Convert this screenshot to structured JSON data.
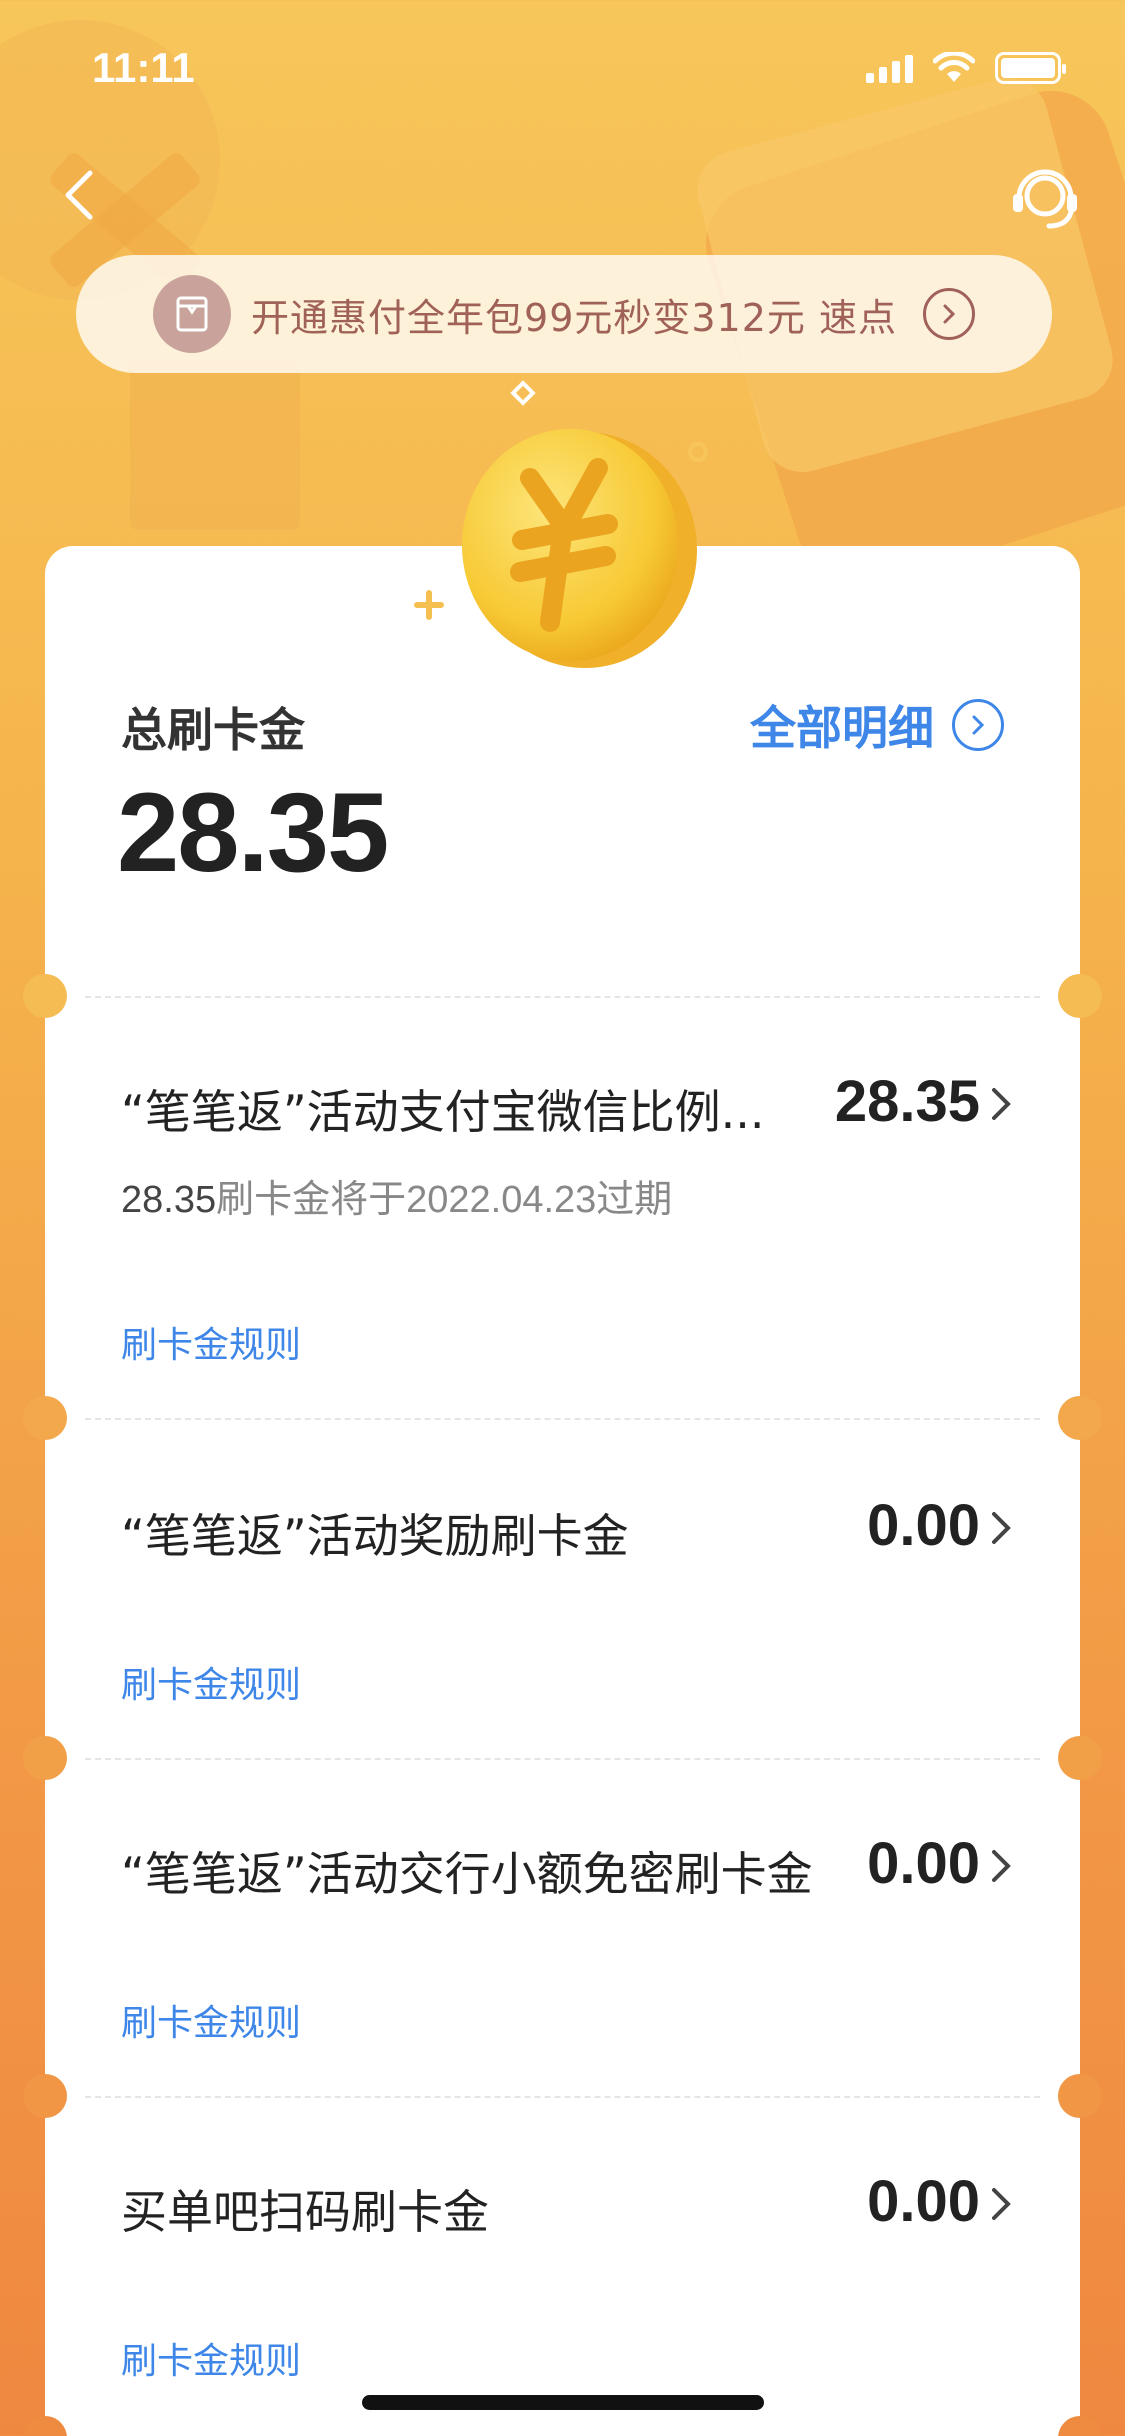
{
  "status_bar": {
    "time": "11:11"
  },
  "nav": {
    "back_icon": "chevron-left-icon",
    "service_icon": "customer-service-icon"
  },
  "promo": {
    "text": "开通惠付全年包99元秒变312元  速点",
    "icon": "ticket-icon",
    "arrow_icon": "circle-arrow-right-icon"
  },
  "summary": {
    "label": "总刷卡金",
    "amount": "28.35",
    "detail_link": "全部明细"
  },
  "items": [
    {
      "title": "“笔笔返”活动支付宝微信比例...",
      "amount": "28.35",
      "sub_amount": "28.35",
      "sub_text": "刷卡金将于",
      "sub_date": "2022.04.23",
      "sub_suffix": "过期",
      "rule": "刷卡金规则"
    },
    {
      "title": "“笔笔返”活动奖励刷卡金",
      "amount": "0.00",
      "rule": "刷卡金规则"
    },
    {
      "title": "“笔笔返”活动交行小额免密刷卡金",
      "amount": "0.00",
      "rule": "刷卡金规则"
    },
    {
      "title": "买单吧扫码刷卡金",
      "amount": "0.00",
      "rule": "刷卡金规则"
    }
  ],
  "colors": {
    "accent": "#3e86e8",
    "bg_top": "#f7c65a",
    "bg_bottom": "#ef8740"
  }
}
